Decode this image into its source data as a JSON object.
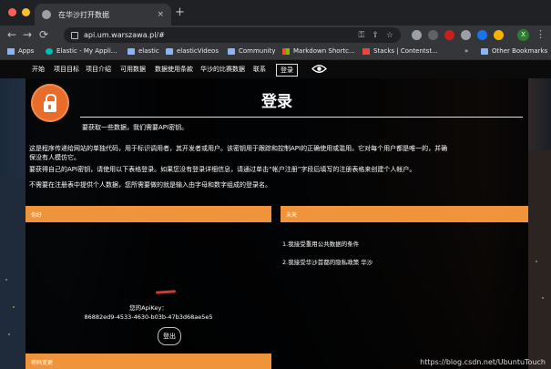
{
  "browser": {
    "tab_title": "在华沙打开数据",
    "tab_close": "×",
    "new_tab": "+",
    "back": "←",
    "forward": "→",
    "reload": "⟳",
    "home": "⌂",
    "url": "api.um.warszawa.pl/#",
    "profile_initial": "X",
    "menu": "⋮",
    "colors": {
      "close": "#ff5f57",
      "minimize": "#febc2e",
      "zoom": "#28c840"
    },
    "bookmarks": [
      {
        "label": "Apps",
        "icon": "apps-grid-icon"
      },
      {
        "label": "Elastic - My Appli...",
        "icon": "elastic-icon"
      },
      {
        "label": "elastic",
        "icon": "folder-icon"
      },
      {
        "label": "elasticVideos",
        "icon": "folder-icon"
      },
      {
        "label": "Community",
        "icon": "folder-icon"
      },
      {
        "label": "Markdown Shortc...",
        "icon": "microsoft-icon"
      },
      {
        "label": "Stacks | Contentst...",
        "icon": "stacks-icon"
      },
      {
        "label": "»",
        "icon": ""
      },
      {
        "label": "Other Bookmarks",
        "icon": "folder-icon"
      }
    ]
  },
  "site_nav": {
    "items": [
      "开始",
      "项目目标",
      "项目介绍",
      "可用数据",
      "数据使用条款",
      "华沙的比赛数据",
      "联系"
    ],
    "login_button": "登录",
    "eye_icon": "eye-icon"
  },
  "login": {
    "title": "登录",
    "intro": "要获取一些数据，我们需要API密钥。",
    "para1_line1": "这是程序传递给网站的单独代码，用于标识调用者，其开发者或用户。该密钥用于跟踪和控制API的正确使用或滥用。它对每个用户都是唯一的，并确",
    "para1_line2": "保没有人模仿它。",
    "para2": "要获得自己的API密钥，请使用以下表格登录。如果您没有登录详细信息，请通过单击“帐户注册”字段后填写的注册表格来创建个人帐户。",
    "para3": "不需要在注册表中提供个人数据，您所需要做的就是输入由字母和数字组成的登录名。"
  },
  "panel_left": {
    "header": "你好",
    "apikey_label": "您的ApiKey：",
    "apikey_value": "86882ed9-4533-4630-b03b-47b3d68ae5e5",
    "logout_button": "登出"
  },
  "panel_right": {
    "header": "未来",
    "lines": [
      "1.我接受重用公共数据的条件",
      "2.我接受华沙首都的隐私政策 华沙"
    ]
  },
  "panel_change_password": {
    "header": "密码变更"
  },
  "accent_color": "#f0943c",
  "watermark": "https://blog.csdn.net/UbuntuTouch"
}
